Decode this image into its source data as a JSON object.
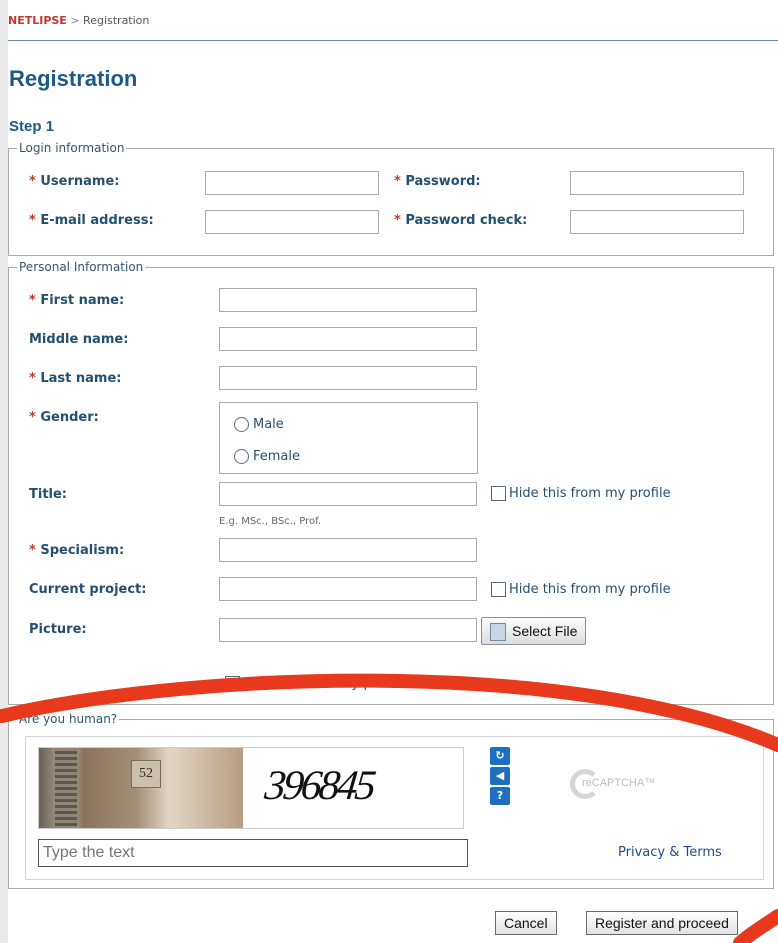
{
  "breadcrumb": {
    "brand": "NETLIPSE",
    "separator": ">",
    "current": "Registration"
  },
  "page_title": "Registration",
  "step_title": "Step 1",
  "login_info": {
    "legend": "Login information",
    "required_marker": "*",
    "username_label": "Username:",
    "password_label": "Password:",
    "email_label": "E-mail address:",
    "password_check_label": "Password check:",
    "username_value": "",
    "password_value": "",
    "email_value": "",
    "password_check_value": ""
  },
  "personal_info": {
    "legend": "Personal Information",
    "first_name_label": "First name:",
    "middle_name_label": "Middle name:",
    "last_name_label": "Last name:",
    "gender_label": "Gender:",
    "gender_options": [
      "Male",
      "Female"
    ],
    "title_label": "Title:",
    "title_hint": "E.g. MSc., BSc., Prof.",
    "specialism_label": "Specialism:",
    "current_project_label": "Current project:",
    "picture_label": "Picture:",
    "select_file_label": "Select File",
    "hide_from_profile_label": "Hide this from my profile"
  },
  "captcha": {
    "legend": "Are you human?",
    "image_text": "396845",
    "photo_sign": "52",
    "input_placeholder": "Type the text",
    "privacy_label": "Privacy & Terms",
    "logo_text": "reCAPTCHA™",
    "reload_glyph": "↻",
    "audio_glyph": "◀",
    "help_glyph": "?"
  },
  "buttons": {
    "cancel": "Cancel",
    "register": "Register and proceed"
  },
  "colors": {
    "accent": "#1d5b86",
    "required": "#c0392b",
    "annotation": "#e8391d"
  }
}
